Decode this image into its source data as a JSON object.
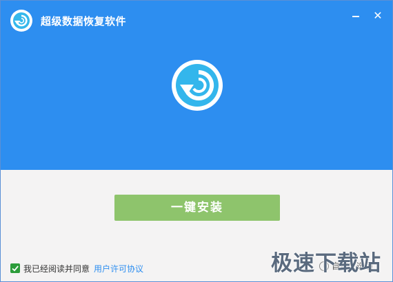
{
  "window": {
    "title": "超级数据恢复软件",
    "close_glyph": "✕",
    "app_icon": "restore-arrow-icon",
    "hero_icon": "restore-arrow-icon"
  },
  "main": {
    "install_button_label": "一键安装"
  },
  "footer": {
    "agreement_checked": true,
    "agreement_text": "我已经阅读并同意",
    "license_link_text": "用户许可协议",
    "custom_install_text": "自定义选项",
    "info_glyph": "i"
  },
  "watermark": {
    "text": "极速下载站"
  },
  "colors": {
    "header_blue": "#2d8ef0",
    "icon_cyan": "#35b8ec",
    "install_green": "#8ec46c",
    "checkbox_green": "#2c9c3a"
  }
}
